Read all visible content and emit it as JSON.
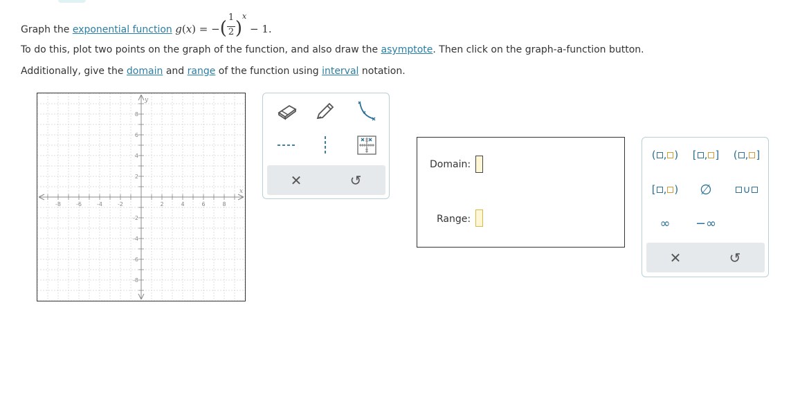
{
  "problem": {
    "line1_prefix": "Graph the",
    "line1_link": "exponential function",
    "func_name": "g",
    "func_var": "x",
    "func_eq": "=",
    "func_minus": "−",
    "frac_num": "1",
    "frac_den": "2",
    "exponent": "x",
    "func_tail": "− 1.",
    "line2_a": "To do this, plot two points on the graph of the function, and also draw the",
    "line2_link": "asymptote",
    "line2_b": ". Then click on the graph-a-function button.",
    "line3_a": "Additionally, give the",
    "line3_link1": "domain",
    "line3_and": "and",
    "line3_link2": "range",
    "line3_b": "of the function using",
    "line3_link3": "interval",
    "line3_c": "notation."
  },
  "graph": {
    "x_label": "x",
    "y_label": "y",
    "x_ticks": [
      "-8",
      "-6",
      "-4",
      "-2",
      "2",
      "4",
      "6",
      "8"
    ],
    "y_ticks": [
      "8",
      "6",
      "4",
      "2",
      "-2",
      "-4",
      "-6",
      "-8"
    ]
  },
  "toolbox": {
    "tools": [
      {
        "name": "eraser-icon"
      },
      {
        "name": "pencil-icon"
      },
      {
        "name": "exponential-curve-icon"
      },
      {
        "name": "dashed-line-icon"
      },
      {
        "name": "vertical-dashed-line-icon"
      },
      {
        "name": "graph-a-function-icon"
      }
    ],
    "clear_label": "✕",
    "undo_label": "↺"
  },
  "answer": {
    "domain_label": "Domain:",
    "range_label": "Range:",
    "domain_value": "",
    "range_value": ""
  },
  "palette": {
    "open_open_l": "(",
    "open_open_r": ")",
    "closed_closed_l": "[",
    "closed_closed_r": "]",
    "open_closed_l": "(",
    "open_closed_r": "]",
    "closed_open_l": "[",
    "closed_open_r": ")",
    "comma": ",",
    "empty_set": "∅",
    "union": "∪",
    "infinity": "∞",
    "neg_infinity": "−∞",
    "clear_label": "✕",
    "undo_label": "↺"
  },
  "colors": {
    "link": "#2a7fa5",
    "palette_blue": "#2a6f95",
    "input_fill": "#fff6d6",
    "input_border": "#d9b84a",
    "tool_gray": "#e6e9ec"
  }
}
